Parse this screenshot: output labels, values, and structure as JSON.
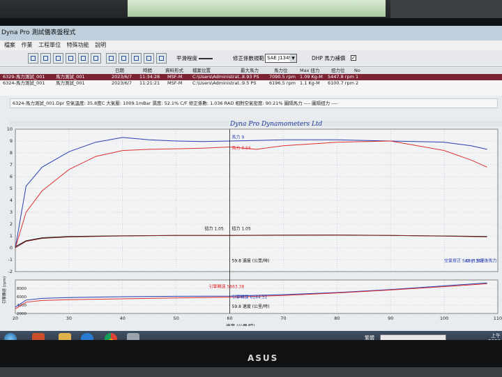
{
  "window": {
    "title": "Dyna Pro 測試儀表盤程式"
  },
  "menu": [
    "檔案",
    "作業",
    "工程單位",
    "特殊功能",
    "說明"
  ],
  "toolbar": {
    "smooth_label": "平滑程度",
    "correction_label": "修正係數規範",
    "correction_value": "SAE J1349",
    "dhp_label": "DHP 馬力補償",
    "dhp_checked": true
  },
  "table": {
    "headers": [
      "",
      "日期",
      "時間",
      "資料形式",
      "檔案位置",
      "最大馬力",
      "馬力位",
      "Max 扭力",
      "扭力位",
      "No"
    ],
    "rows": [
      {
        "name": "6329-馬力測試_001",
        "label": "馬力測試_001",
        "date": "2023/6/7",
        "time": "11:34:28",
        "type": "MSF-M",
        "path": "C:\\Users\\Administrat...",
        "max_power": "8.93 PS",
        "power_rpm": "7090.5 rpm",
        "max_torque": "1.09 Kg-M",
        "torque_rpm": "5447.8 rpm",
        "no": "1"
      },
      {
        "name": "6324-馬力測試_001",
        "label": "馬力測試_001",
        "date": "2023/6/7",
        "time": "11:21:21",
        "type": "MSF-M",
        "path": "C:\\Users\\Administrat...",
        "max_power": "9.5 PS",
        "power_rpm": "6196.5 rpm",
        "max_torque": "1.1 Kg-M",
        "torque_rpm": "6100.7 rpm",
        "no": "2"
      }
    ]
  },
  "info_bar": "6324-馬力測試_001.Dpr  空氣溫度: 35.8度C  大氣壓: 1009.1mBar  濕度: 52.1%  C/F 修正係數: 1.036  RAD 相對空氣密度: 90.21%  圖隔馬力 ----  圖隔扭力 ----",
  "chart_data": [
    {
      "type": "line",
      "title": "Dyna Pro Dynamometers Ltd",
      "xlabel": "速度 (公里/時)",
      "ylim": [
        -2,
        10
      ],
      "yticks": [
        -2,
        -1,
        0,
        1,
        2,
        3,
        4,
        5,
        6,
        7,
        8,
        9,
        10
      ],
      "xlim": [
        20,
        110
      ],
      "xticks": [
        20,
        30,
        40,
        50,
        60,
        70,
        80,
        90,
        100,
        110
      ],
      "grid": true,
      "cursor_x": 60,
      "series": [
        {
          "name": "馬力",
          "color": "#2a3fb0",
          "x": [
            20,
            22,
            25,
            30,
            35,
            40,
            45,
            50,
            55,
            60,
            70,
            80,
            90,
            100,
            105,
            108
          ],
          "values": [
            0,
            5.2,
            6.8,
            8.1,
            8.9,
            9.3,
            9.1,
            9.0,
            8.95,
            9.0,
            9.1,
            9.1,
            9.0,
            8.9,
            8.6,
            8.3
          ]
        },
        {
          "name": "馬力",
          "color": "#e03030",
          "x": [
            20,
            22,
            25,
            30,
            35,
            40,
            45,
            50,
            55,
            60,
            65,
            70,
            80,
            90,
            95,
            100,
            105,
            108
          ],
          "values": [
            0,
            3.0,
            4.8,
            6.6,
            7.7,
            8.2,
            8.3,
            8.35,
            8.4,
            8.5,
            8.3,
            8.6,
            8.9,
            9.0,
            8.6,
            8.2,
            7.4,
            6.8
          ]
        },
        {
          "name": "扭力",
          "color": "#111111",
          "x": [
            20,
            22,
            25,
            30,
            40,
            50,
            60,
            70,
            80,
            90,
            100,
            108
          ],
          "values": [
            0.1,
            0.6,
            0.85,
            0.95,
            1.02,
            1.05,
            1.05,
            1.07,
            1.08,
            1.05,
            1.0,
            0.95
          ]
        },
        {
          "name": "扭力",
          "color": "#8a2020",
          "x": [
            20,
            22,
            25,
            30,
            40,
            50,
            60,
            70,
            80,
            90,
            100,
            108
          ],
          "values": [
            0.0,
            0.55,
            0.8,
            0.92,
            1.0,
            1.04,
            1.05,
            1.06,
            1.07,
            1.04,
            0.98,
            0.93
          ]
        }
      ],
      "annotations": [
        "馬力 9",
        "馬力 8.56",
        "扭力 1.05",
        "扭力 1.05",
        "59.8 速度 (公里/時)",
        "空氣修正 SAE J1349",
        "DHP 空定後馬力"
      ]
    },
    {
      "type": "line",
      "ylabel": "引擎轉速 (rpm)",
      "ylim": [
        2000,
        10000
      ],
      "yticks": [
        2000,
        4000,
        6000,
        8000
      ],
      "xlim": [
        20,
        110
      ],
      "series": [
        {
          "name": "引擎轉速",
          "color": "#2a3fb0",
          "x": [
            20,
            22,
            25,
            30,
            40,
            50,
            60,
            70,
            80,
            90,
            100,
            108
          ],
          "values": [
            3500,
            5200,
            5600,
            5800,
            6000,
            6100,
            6150,
            6500,
            7000,
            7700,
            8600,
            9300
          ]
        },
        {
          "name": "引擎轉速",
          "color": "#e03030",
          "x": [
            20,
            22,
            25,
            30,
            40,
            50,
            60,
            70,
            80,
            90,
            100,
            108
          ],
          "values": [
            3100,
            4700,
            5100,
            5300,
            5500,
            5700,
            5900,
            6300,
            6900,
            7600,
            8400,
            9100
          ]
        }
      ],
      "annotations": [
        "引擎轉速 5863.38",
        "引擎轉速 6144.31",
        "59.8 速度 (公里/時)"
      ]
    }
  ],
  "taskbar": {
    "lang": "繁體",
    "clock": "上午\n2023"
  },
  "monitor_brand": "ASUS"
}
